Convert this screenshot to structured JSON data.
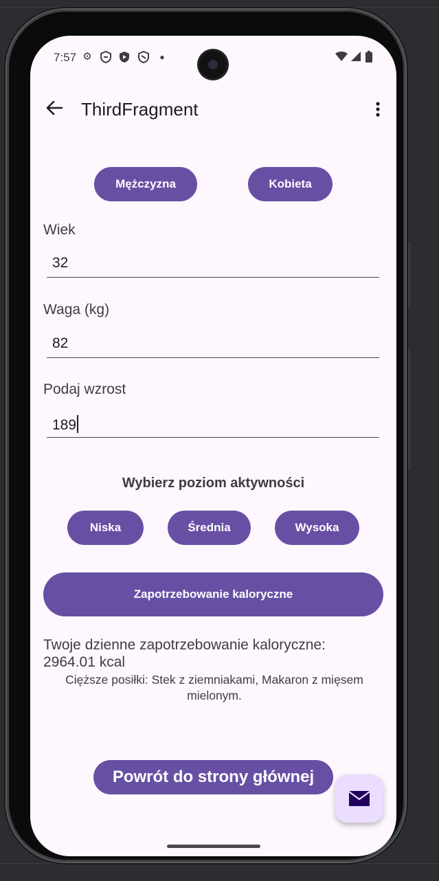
{
  "status_bar": {
    "time": "7:57",
    "left_icons": [
      "settings-icon",
      "shield-icon",
      "play-shield-icon",
      "shield-outline-icon",
      "dot-icon"
    ],
    "right_icons": [
      "wifi-icon",
      "signal-icon",
      "battery-icon"
    ]
  },
  "app_bar": {
    "title": "ThirdFragment",
    "back_icon": "arrow-back-icon",
    "menu_icon": "more-vert-icon"
  },
  "gender": {
    "male_label": "Mężczyzna",
    "female_label": "Kobieta"
  },
  "form": {
    "age_label": "Wiek",
    "age_value": "32",
    "weight_label": "Waga (kg)",
    "weight_value": "82",
    "height_label": "Podaj wzrost",
    "height_value": "189"
  },
  "activity": {
    "heading": "Wybierz poziom aktywności",
    "low_label": "Niska",
    "medium_label": "Średnia",
    "high_label": "Wysoka"
  },
  "calculate_button_label": "Zapotrzebowanie kaloryczne",
  "result": {
    "line1": "Twoje dzienne zapotrzebowanie kaloryczne:",
    "line2": "2964.01 kcal",
    "meals": "Cięższe posiłki: Stek z ziemniakami, Makaron z mięsem mielonym."
  },
  "home_button_label": "Powrót do strony głównej",
  "fab_icon": "mail-icon",
  "colors": {
    "primary": "#6750a4",
    "background": "#fef7fd",
    "fab": "#eaddff",
    "fab_icon": "#21005d"
  }
}
